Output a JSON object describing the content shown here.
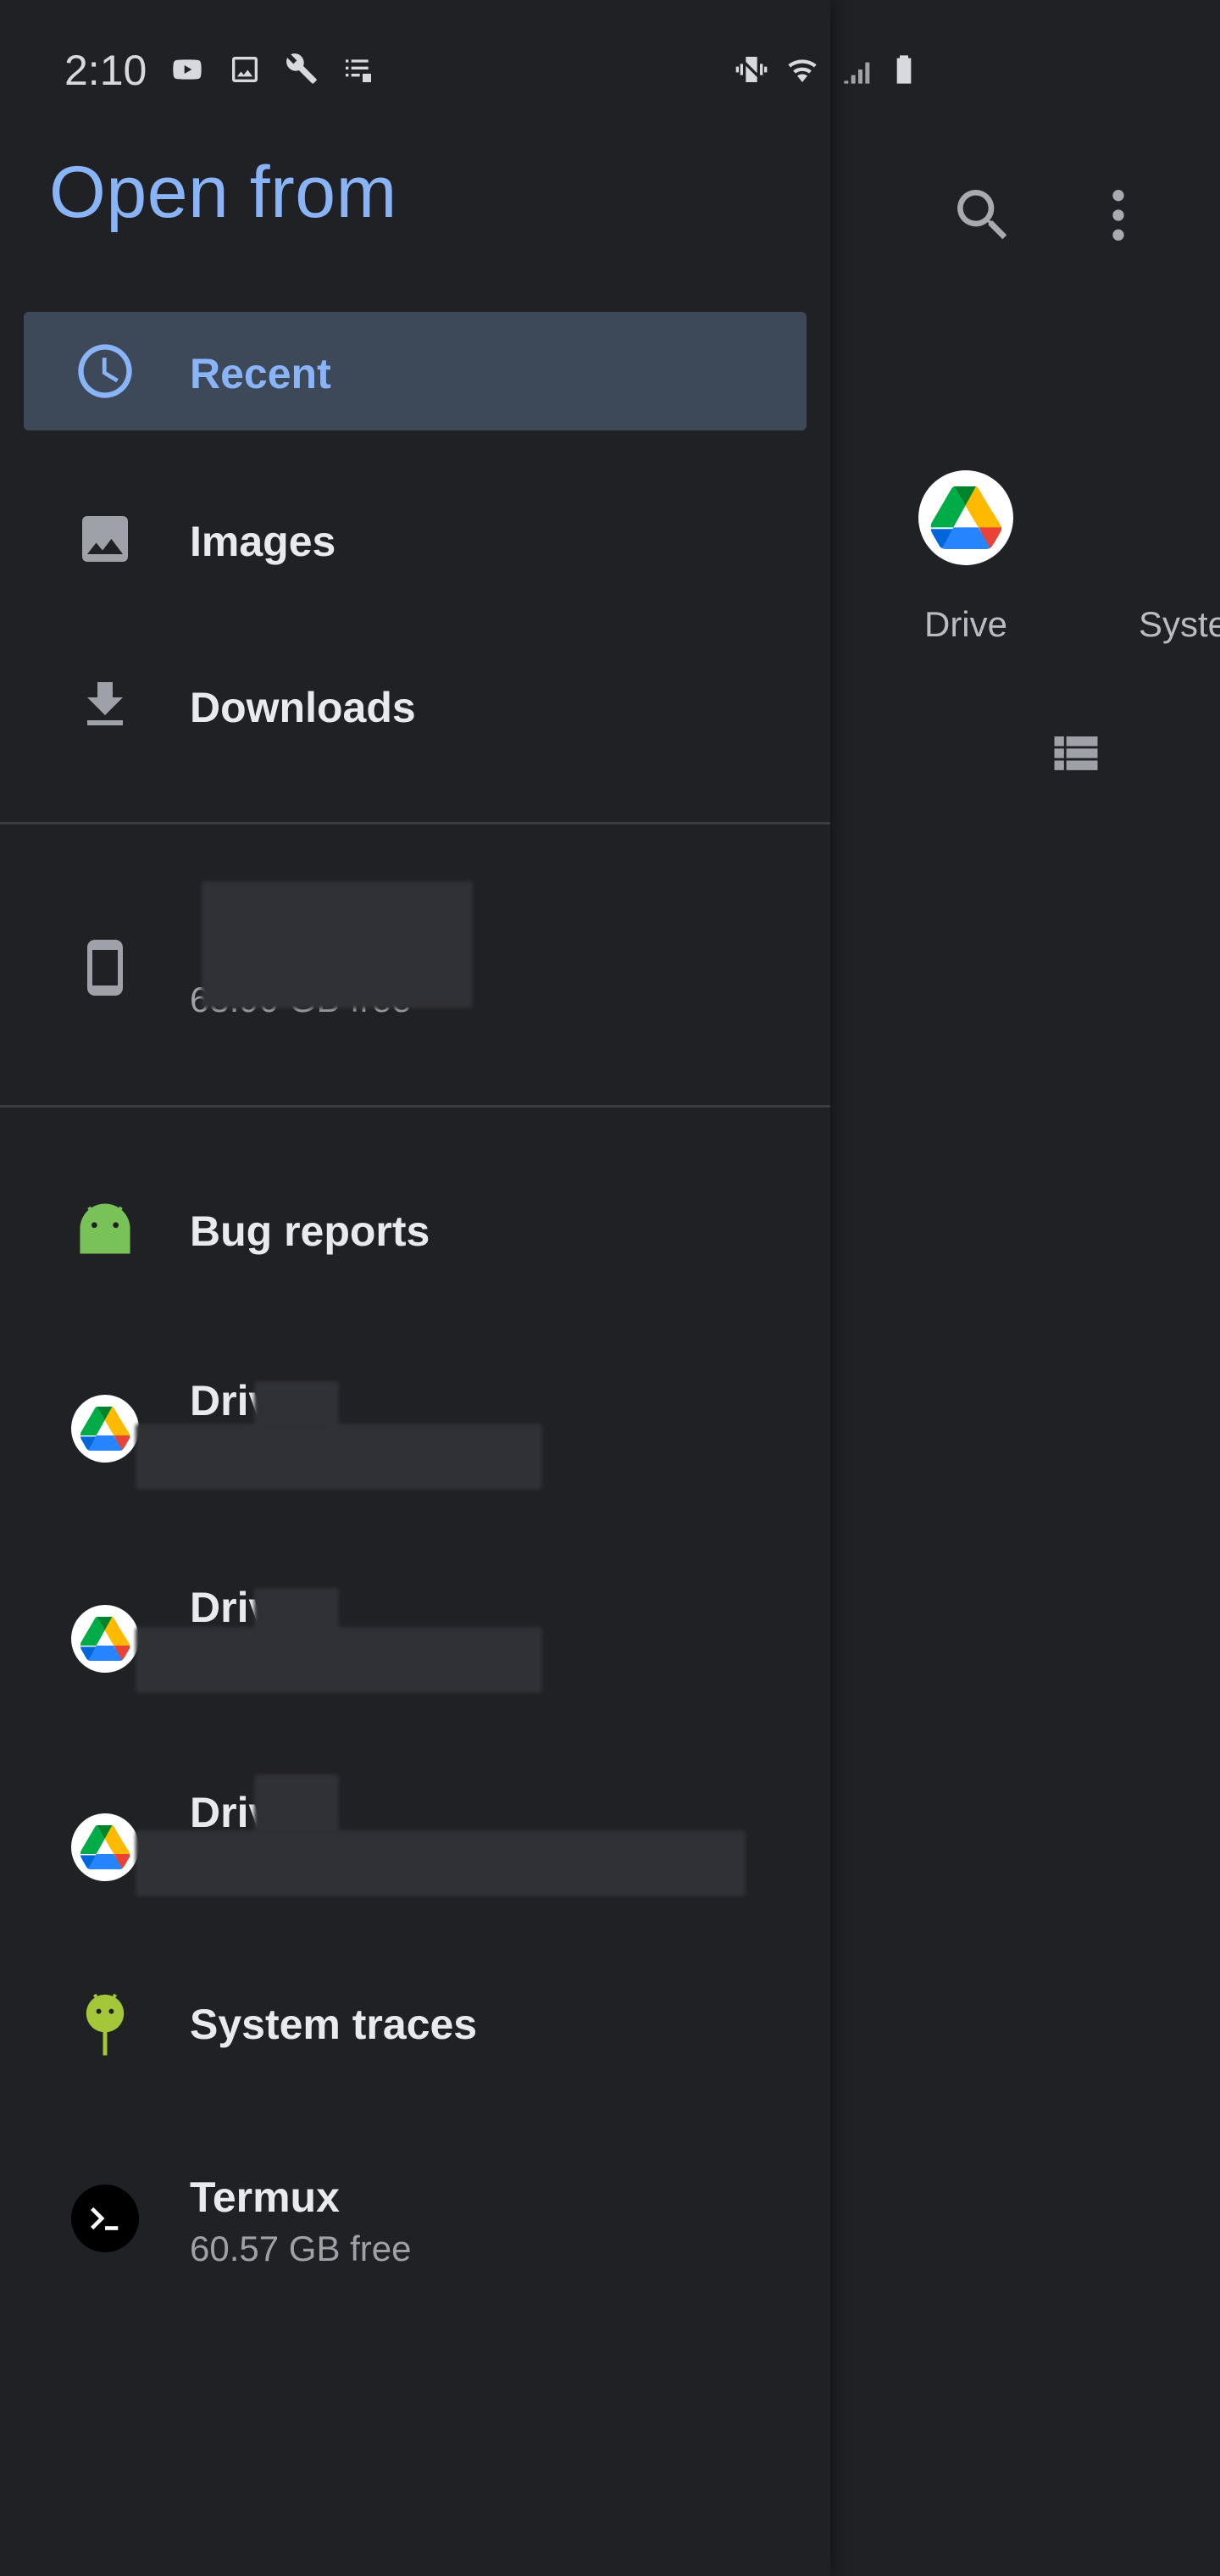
{
  "status_bar": {
    "time": "2:10",
    "icons": [
      "youtube-icon",
      "image-icon",
      "tools-icon",
      "checklist-icon",
      "vibrate-icon",
      "wifi-icon",
      "signal-icon",
      "battery-icon"
    ]
  },
  "app": {
    "root_tiles": [
      {
        "label": "Drive",
        "icon": "google-drive-icon"
      },
      {
        "label": "Syste",
        "icon": "android-icon"
      }
    ]
  },
  "drawer": {
    "title": "Open from",
    "items": [
      {
        "label": "Recent",
        "icon": "clock-icon",
        "selected": true
      },
      {
        "label": "Images",
        "icon": "image-icon",
        "selected": false
      },
      {
        "label": "Downloads",
        "icon": "download-icon",
        "selected": false
      }
    ],
    "device": {
      "subtitle": "63.90 GB free",
      "icon": "phone-icon"
    },
    "providers": [
      {
        "label": "Bug reports",
        "icon": "android-icon"
      },
      {
        "label": "Drive",
        "icon": "google-drive-icon"
      },
      {
        "label": "Drive",
        "icon": "google-drive-icon"
      },
      {
        "label": "Drive",
        "icon": "google-drive-icon"
      },
      {
        "label": "System traces",
        "icon": "android-debug-icon"
      },
      {
        "label": "Termux",
        "subtitle": "60.57 GB free",
        "icon": "terminal-icon"
      }
    ]
  },
  "colors": {
    "background": "#202125",
    "accent": "#8ab4f8",
    "selected_bg": "#3d4859",
    "text_primary": "#e8eaed",
    "text_secondary": "#9ea1a7",
    "android_green": "#78c257"
  }
}
